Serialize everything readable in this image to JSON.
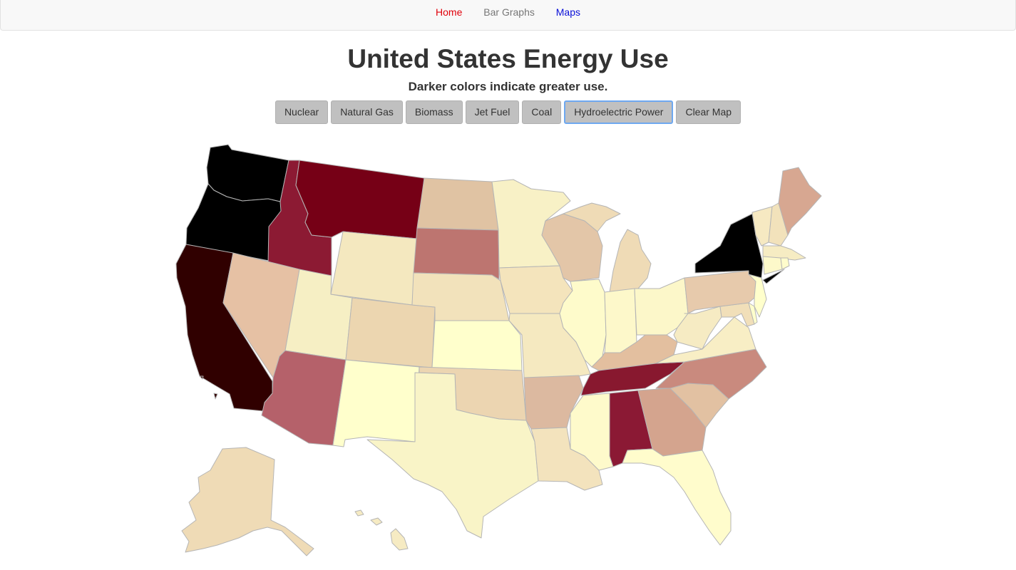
{
  "nav": {
    "items": [
      {
        "label": "Home",
        "color": "#e0000a"
      },
      {
        "label": "Bar Graphs",
        "color": "#777777"
      },
      {
        "label": "Maps",
        "color": "#0a10d8"
      }
    ]
  },
  "page": {
    "title": "United States Energy Use",
    "subtitle": "Darker colors indicate greater use."
  },
  "buttons": {
    "nuclear": "Nuclear",
    "natural_gas": "Natural Gas",
    "biomass": "Biomass",
    "jet_fuel": "Jet Fuel",
    "coal": "Coal",
    "hydro": "Hydroelectric Power",
    "clear": "Clear Map"
  },
  "map": {
    "active_layer": "Hydroelectric Power",
    "colors": {
      "WA": "#000000",
      "OR": "#000000",
      "CA": "#300000",
      "ID": "#8c1a33",
      "MT": "#760016",
      "NV": "#e6c1a4",
      "UT": "#f6efc4",
      "AZ": "#b5616a",
      "WY": "#f4e8bf",
      "CO": "#ecd6b0",
      "NM": "#ffffcc",
      "ND": "#e0c3a3",
      "SD": "#bd7570",
      "NE": "#f2e2bb",
      "KS": "#ffffcc",
      "OK": "#ecd5b1",
      "TX": "#f9f4c7",
      "MN": "#f8f1c6",
      "IA": "#f4e4bc",
      "MO": "#f5e9c0",
      "AR": "#dcb9a0",
      "LA": "#f3e3bd",
      "WI": "#e3c6a8",
      "IL": "#fefbcb",
      "MS": "#fefacb",
      "MI": "#efdbb6",
      "IN": "#fdf8ca",
      "KY": "#e3bf9f",
      "TN": "#88182f",
      "AL": "#8b1934",
      "OH": "#fcf7c9",
      "GA": "#d4a48e",
      "FL": "#fffccc",
      "SC": "#e2c1a2",
      "NC": "#c98a7e",
      "VA": "#f8eec5",
      "WV": "#f6ebc3",
      "PA": "#e7caac",
      "NY": "#000000",
      "VT": "#f6e9c2",
      "NH": "#f2e2bb",
      "ME": "#d7a791",
      "MA": "#f6ecc3",
      "CT": "#fdf9ca",
      "RI": "#fffccc",
      "NJ": "#ffffcc",
      "DE": "#ffffcc",
      "MD": "#f1dfb9",
      "AK": "#efdbb6",
      "HI": "#f6ebc3"
    }
  }
}
